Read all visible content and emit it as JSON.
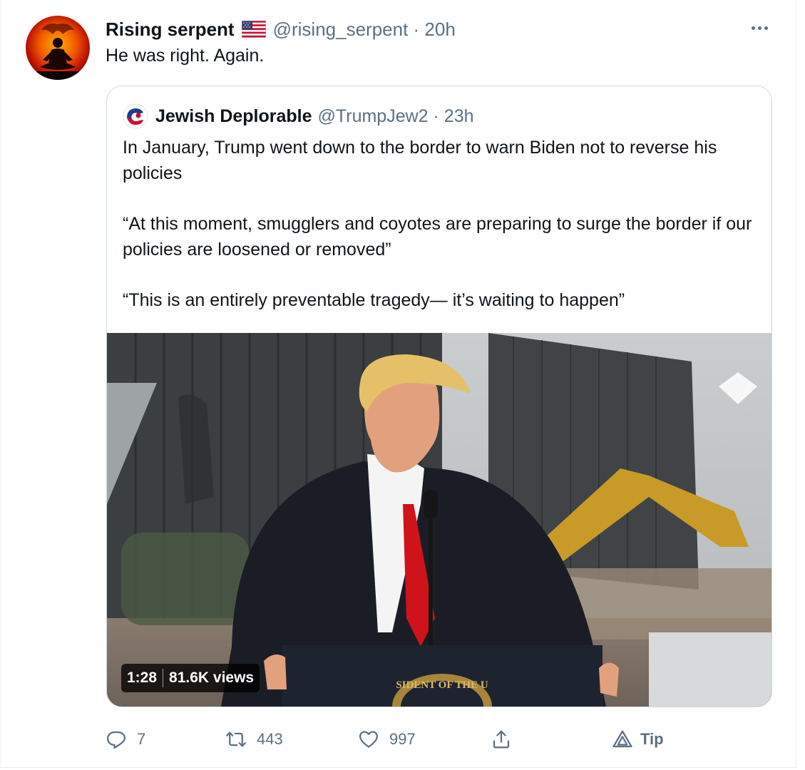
{
  "tweet": {
    "display_name": "Rising serpent",
    "flag_icon": "us-flag-icon",
    "handle_time": "@rising_serpent · 20h",
    "text": "He was right. Again.",
    "more_icon": "more-horizontal-icon"
  },
  "quoted": {
    "display_name": "Jewish Deplorable",
    "handle_time": "@TrumpJew2 · 23h",
    "paragraphs": [
      "In January, Trump went down to the border to warn Biden not to reverse his policies",
      "“At this moment, smugglers and coyotes are preparing to surge the border if our policies are loosened or removed”",
      "“This is an entirely preventable tragedy— it’s waiting to happen”"
    ],
    "video": {
      "duration": "1:28",
      "views": "81.6K views",
      "podium_seal_text": "SIDENT OF THE U"
    }
  },
  "actions": {
    "reply": {
      "icon": "reply-icon",
      "count": "7"
    },
    "retweet": {
      "icon": "retweet-icon",
      "count": "443"
    },
    "like": {
      "icon": "heart-icon",
      "count": "997"
    },
    "share": {
      "icon": "share-icon",
      "count": ""
    },
    "tip": {
      "icon": "tip-icon",
      "label": "Tip"
    }
  },
  "colors": {
    "text_primary": "#0f1419",
    "text_secondary": "#5b7083",
    "border": "#cfd9de",
    "tie_red": "#d0121b"
  }
}
